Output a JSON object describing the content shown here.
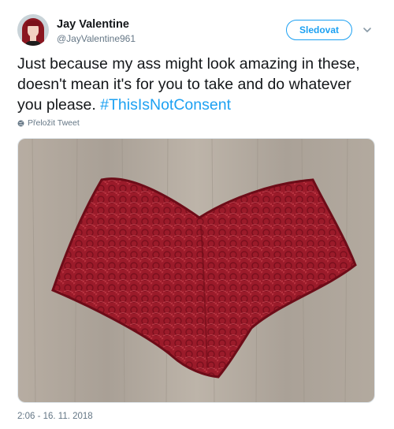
{
  "author": {
    "name": "Jay Valentine",
    "handle": "@JayValentine961"
  },
  "follow_button": {
    "label": "Sledovat"
  },
  "tweet": {
    "text": "Just because my ass might look amazing in these, doesn't mean it's for you to take and do whatever you please. ",
    "hashtag": "#ThisIsNotConsent"
  },
  "translate": {
    "label": "Přeložit Tweet"
  },
  "timestamp": "2:06 - 16. 11. 2018",
  "colors": {
    "accent": "#1da1f2",
    "secondary_text": "#657786",
    "lace": "#9b1b2a"
  },
  "icons": {
    "more": "chevron-down-icon",
    "translate": "globe-icon"
  }
}
